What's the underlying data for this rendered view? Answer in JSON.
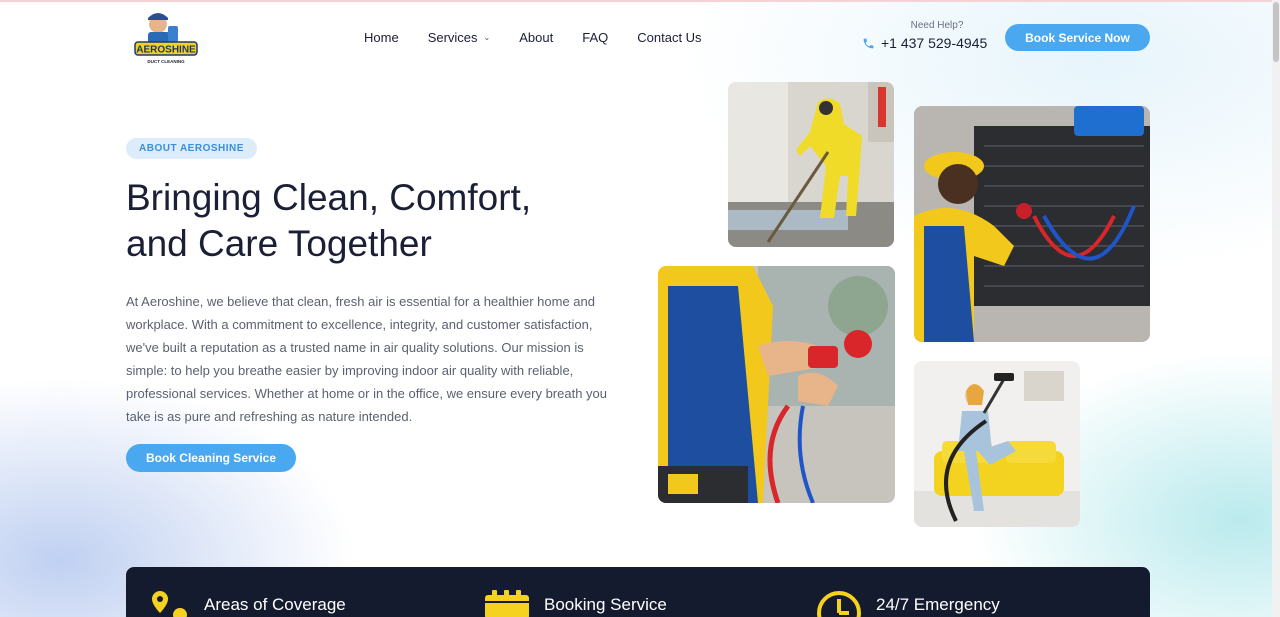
{
  "brand": {
    "logo_text": "AEROSHINE",
    "logo_sub": "DUCT CLEANING"
  },
  "nav": {
    "items": [
      {
        "label": "Home"
      },
      {
        "label": "Services",
        "has_dropdown": true
      },
      {
        "label": "About"
      },
      {
        "label": "FAQ"
      },
      {
        "label": "Contact Us"
      }
    ]
  },
  "contact": {
    "help_label": "Need Help?",
    "phone": "+1 437 529-4945"
  },
  "header_cta": "Book Service Now",
  "hero": {
    "badge": "ABOUT AEROSHINE",
    "title_line1": "Bringing Clean, Comfort,",
    "title_line2": "and Care Together",
    "description": "At Aeroshine, we believe that clean, fresh air is essential for a healthier home and workplace. With a commitment to excellence, integrity, and customer satisfaction, we've built a reputation as a trusted name in air quality solutions. Our mission is simple: to help you breathe easier by improving indoor air quality with reliable, professional services. Whether at home or in the office, we ensure every breath you take is as pure and refreshing as nature intended.",
    "cta": "Book Cleaning Service"
  },
  "features": [
    {
      "title": "Areas of Coverage",
      "icon": "location-pin-icon"
    },
    {
      "title": "Booking Service",
      "icon": "calendar-icon"
    },
    {
      "title": "24/7 Emergency",
      "icon": "clock-icon"
    }
  ],
  "colors": {
    "accent": "#4aa8f0",
    "dark": "#151b2e",
    "icon_yellow": "#f5d21f",
    "text_primary": "#1a1f36",
    "text_muted": "#5b6170"
  }
}
